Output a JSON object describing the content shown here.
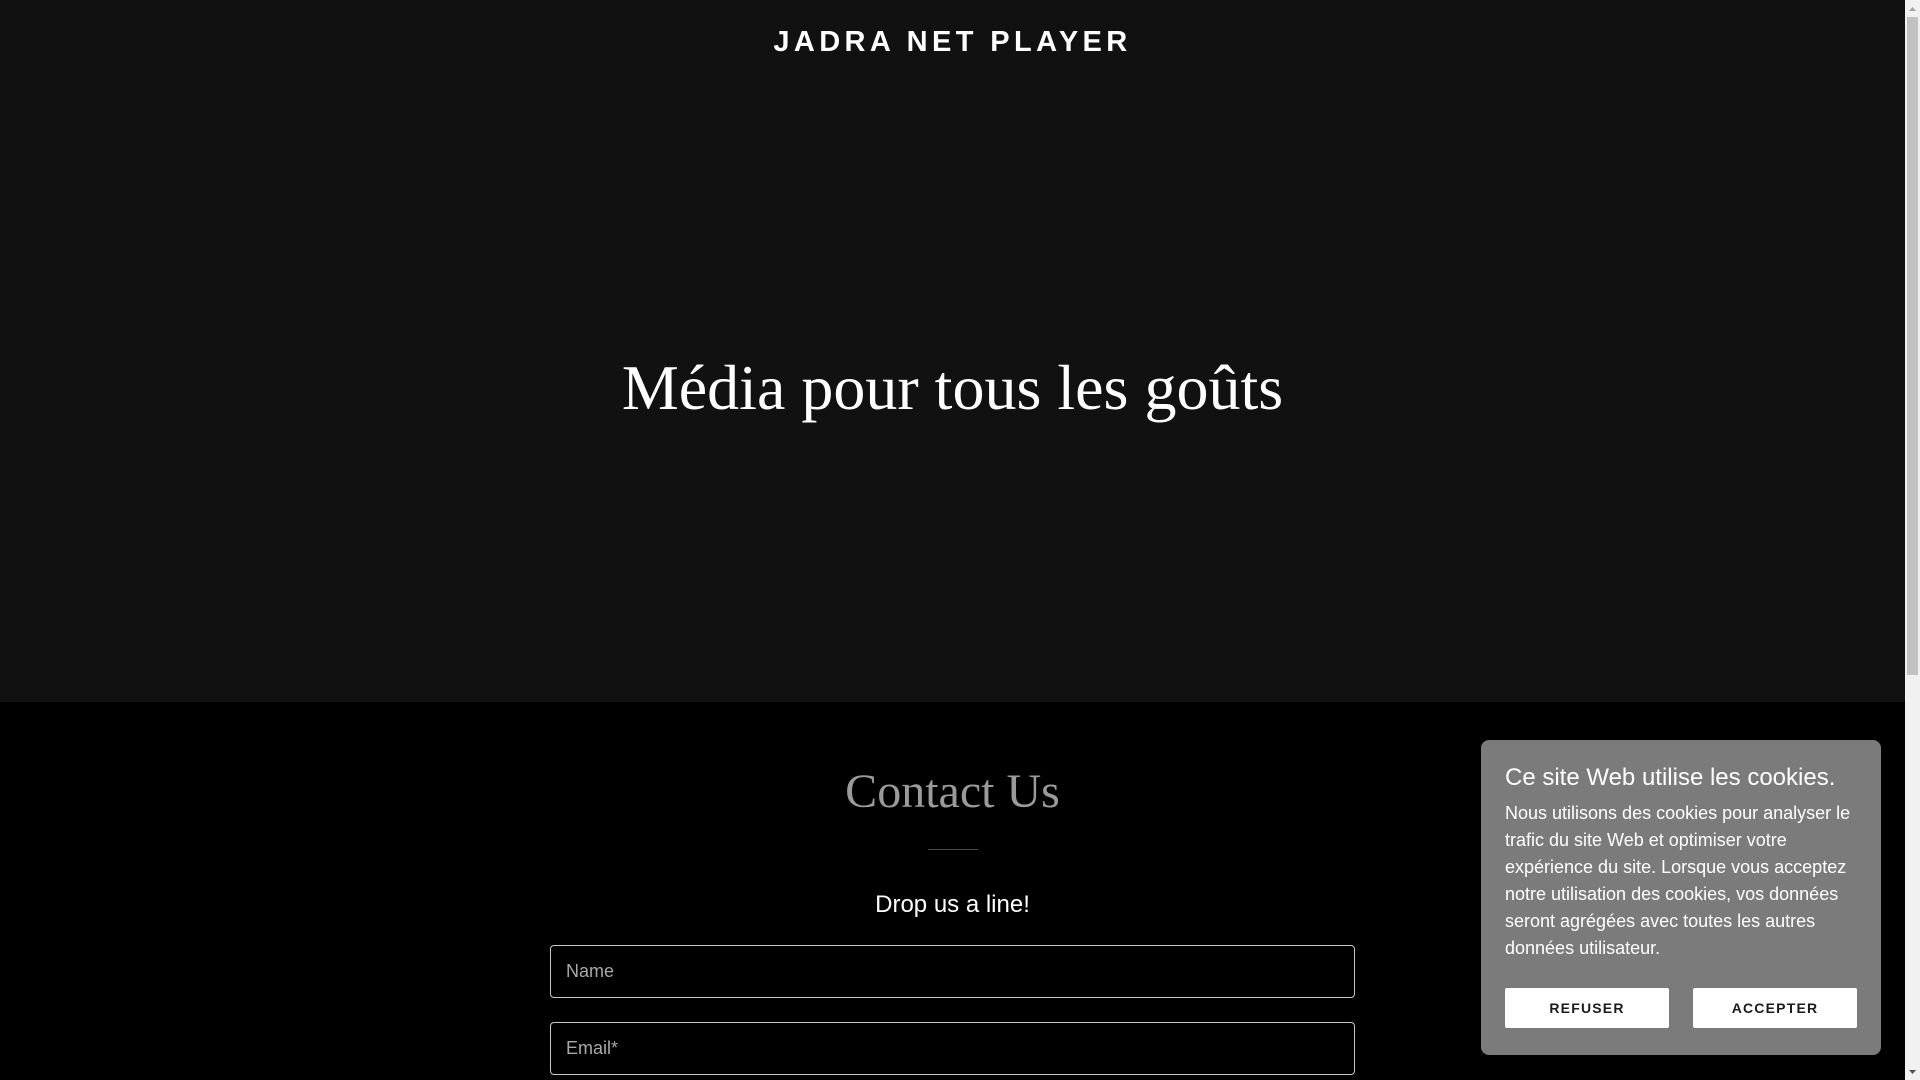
{
  "header": {
    "site_title": "JADRA NET PLAYER"
  },
  "hero": {
    "heading": "Média pour tous les goûts"
  },
  "contact": {
    "heading": "Contact Us",
    "subheading": "Drop us a line!",
    "name_placeholder": "Name",
    "email_placeholder": "Email*"
  },
  "cookie_banner": {
    "title": "Ce site Web utilise les cookies.",
    "text": "Nous utilisons des cookies pour analyser le trafic du site Web et optimiser votre expérience du site. Lorsque vous acceptez notre utilisation des cookies, vos données seront agrégées avec toutes les autres données utilisateur.",
    "refuse_label": "REFUSER",
    "accept_label": "ACCEPTER"
  },
  "scrollbar": {
    "position": 0
  },
  "colors": {
    "page_background": "#000000",
    "hero_background": "#111111",
    "cookie_panel_background": "#7b7b7b",
    "contact_heading": "#9a9a9a",
    "button_background": "#ffffff"
  },
  "icons": {
    "scroll_up": "scroll-up-arrow-icon",
    "scroll_down": "scroll-down-arrow-icon"
  }
}
